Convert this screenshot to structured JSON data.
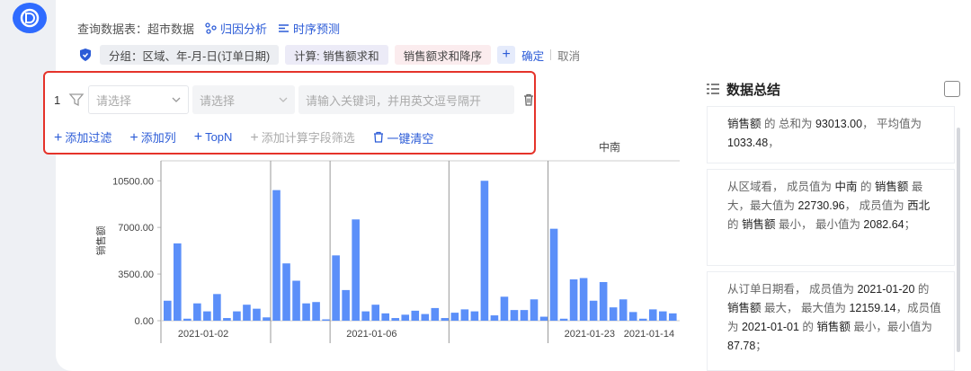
{
  "header": {
    "query_label": "查询数据表：超市数据",
    "attribution": "归因分析",
    "forecast": "时序预测"
  },
  "chips": {
    "group": "分组：区域、年-月-日(订单日期)",
    "calc": "计算: 销售额求和",
    "sort": "销售额求和降序",
    "confirm": "确定",
    "cancel": "取消"
  },
  "filter_panel": {
    "row_index": "1",
    "select1_placeholder": "请选择",
    "select2_placeholder": "请选择",
    "keyword_placeholder": "请输入关键词，并用英文逗号隔开",
    "add_filter": "添加过滤",
    "add_column": "添加列",
    "topn": "TopN",
    "add_calc_filter": "添加计算字段筛选",
    "clear_all": "一键清空"
  },
  "summary": {
    "title": "数据总结",
    "card1": {
      "a": "销售额",
      "b": " 的 总和为 ",
      "c": "93013.00",
      "d": "， 平均值为 ",
      "e": "1033.48",
      "f": "，"
    },
    "card2": {
      "a": "从区域看， 成员值为 ",
      "b": "中南",
      "c": " 的 ",
      "d": "销售额",
      "e": " 最大，最大值为 ",
      "f": "22730.96",
      "g": "， 成员值为 ",
      "h": "西北",
      "i": " 的 ",
      "j": "销售额",
      "k": " 最小， 最小值为 ",
      "l": "2082.64",
      "m": "；"
    },
    "card3": {
      "a": "从订单日期看， 成员值为 ",
      "b": "2021-01-20",
      "c": " 的 ",
      "d": "销售额",
      "e": " 最大， 最大值为 ",
      "f": "12159.14",
      "g": "，成员值为 ",
      "h": "2021-01-01",
      "i": " 的 ",
      "j": "销售额",
      "k": " 最小，最小值为 ",
      "l": "87.78",
      "m": "；"
    }
  },
  "chart_data": {
    "type": "bar",
    "title": "",
    "ylabel": "销售额",
    "ylim": [
      0,
      12000
    ],
    "yticks": [
      "0.00",
      "3500.00",
      "7000.00",
      "10500.00"
    ],
    "ytick_values": [
      0,
      3500,
      7000,
      10500
    ],
    "top_group_label": "中南",
    "x_labels": [
      "2021-01-02",
      "2021-01-06",
      "2021-01-23",
      "2021-01-14"
    ],
    "color": "#5b8ff9",
    "values": [
      1500,
      5800,
      150,
      1300,
      700,
      2000,
      200,
      700,
      1200,
      900,
      250,
      9800,
      4300,
      3000,
      1300,
      1400,
      100,
      4900,
      2300,
      7600,
      700,
      1200,
      550,
      200,
      450,
      750,
      500,
      950,
      200,
      600,
      850,
      700,
      10500,
      400,
      1800,
      800,
      800,
      1600,
      300,
      6900,
      150,
      3100,
      3200,
      1500,
      2900,
      1000,
      1600,
      650,
      150,
      850,
      700,
      550
    ]
  }
}
